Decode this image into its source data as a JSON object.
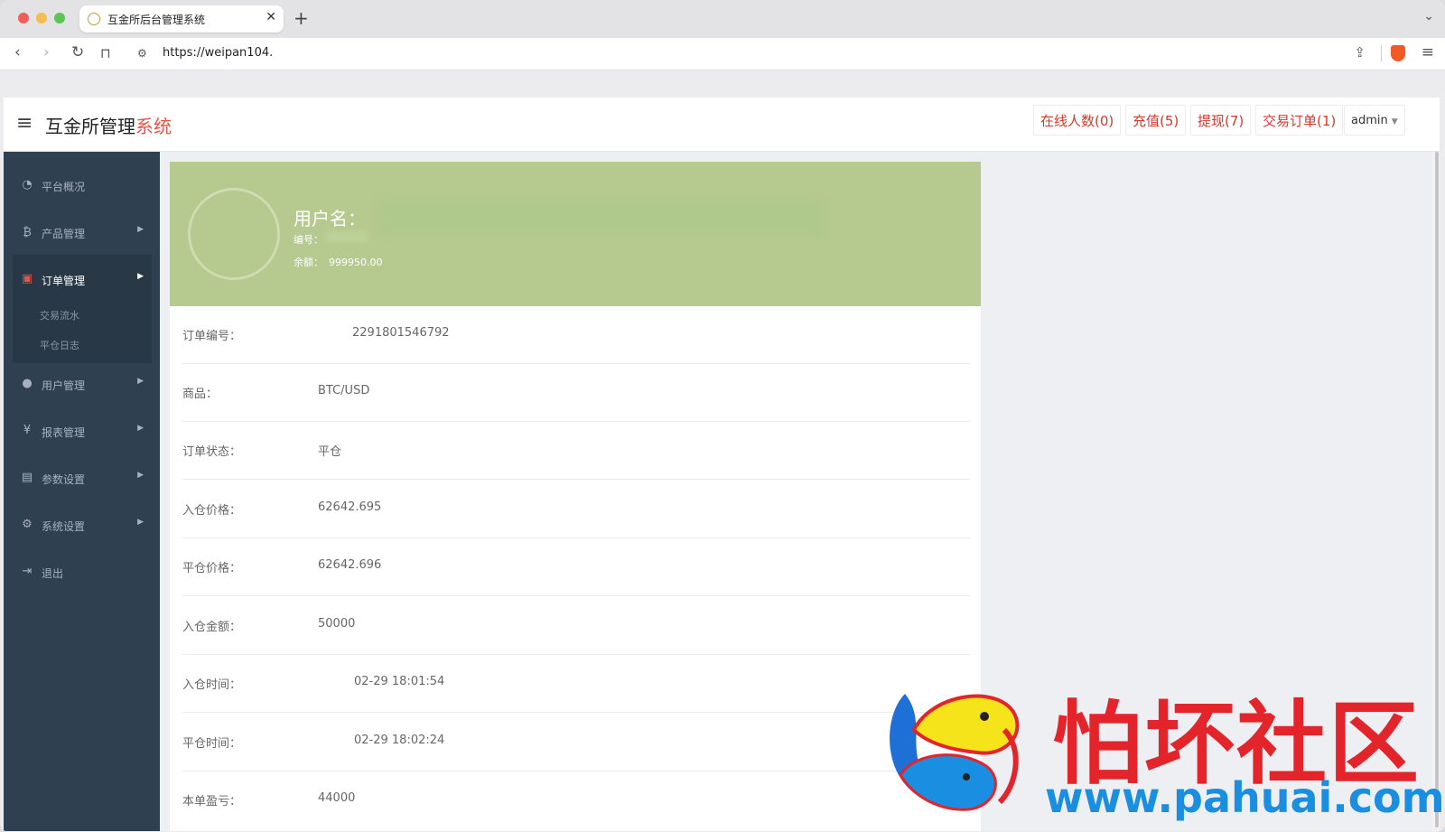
{
  "browser": {
    "tab_title": "互金所后台管理系统",
    "tab_close": "✕",
    "new_tab": "+",
    "url": "https://weipan104."
  },
  "header": {
    "brand_main": "互金所管理",
    "brand_accent": "系统",
    "nav": {
      "online": "在线人数(0)",
      "recharge": "充值(5)",
      "withdraw": "提现(7)",
      "orders": "交易订单(1)",
      "user": "admin"
    }
  },
  "sidebar": {
    "items": [
      {
        "label": "平台概况",
        "icon": "dashboard-icon"
      },
      {
        "label": "产品管理",
        "icon": "bitcoin-icon"
      },
      {
        "label": "订单管理",
        "icon": "orders-icon"
      },
      {
        "label": "用户管理",
        "icon": "user-icon"
      },
      {
        "label": "报表管理",
        "icon": "yen-icon"
      },
      {
        "label": "参数设置",
        "icon": "params-icon"
      },
      {
        "label": "系统设置",
        "icon": "gears-icon"
      },
      {
        "label": "退出",
        "icon": "logout-icon"
      }
    ],
    "sub_items": [
      {
        "label": "交易流水"
      },
      {
        "label": "平仓日志"
      }
    ]
  },
  "profile": {
    "username_label": "用户名：",
    "id_label": "编号：",
    "balance_label": "余额：",
    "balance_value": "999950.00"
  },
  "order": {
    "rows": [
      {
        "label": "订单编号：",
        "value": "2291801546792"
      },
      {
        "label": "商品：",
        "value": "BTC/USD"
      },
      {
        "label": "订单状态：",
        "value": "平仓"
      },
      {
        "label": "入仓价格：",
        "value": "62642.695"
      },
      {
        "label": "平仓价格：",
        "value": "62642.696"
      },
      {
        "label": "入仓金额：",
        "value": "50000"
      },
      {
        "label": "入仓时间：",
        "value": "02-29 18:01:54"
      },
      {
        "label": "平仓时间：",
        "value": "02-29 18:02:24"
      },
      {
        "label": "本单盈亏：",
        "value": "44000"
      }
    ]
  },
  "watermark": {
    "title": "怕坏社区",
    "url": "www.pahuai.com"
  },
  "colors": {
    "sidebar_bg": "#2f4050",
    "profile_bg": "#b6c98e",
    "accent_red": "#e4544b",
    "watermark_blue": "#1a8ee0"
  }
}
